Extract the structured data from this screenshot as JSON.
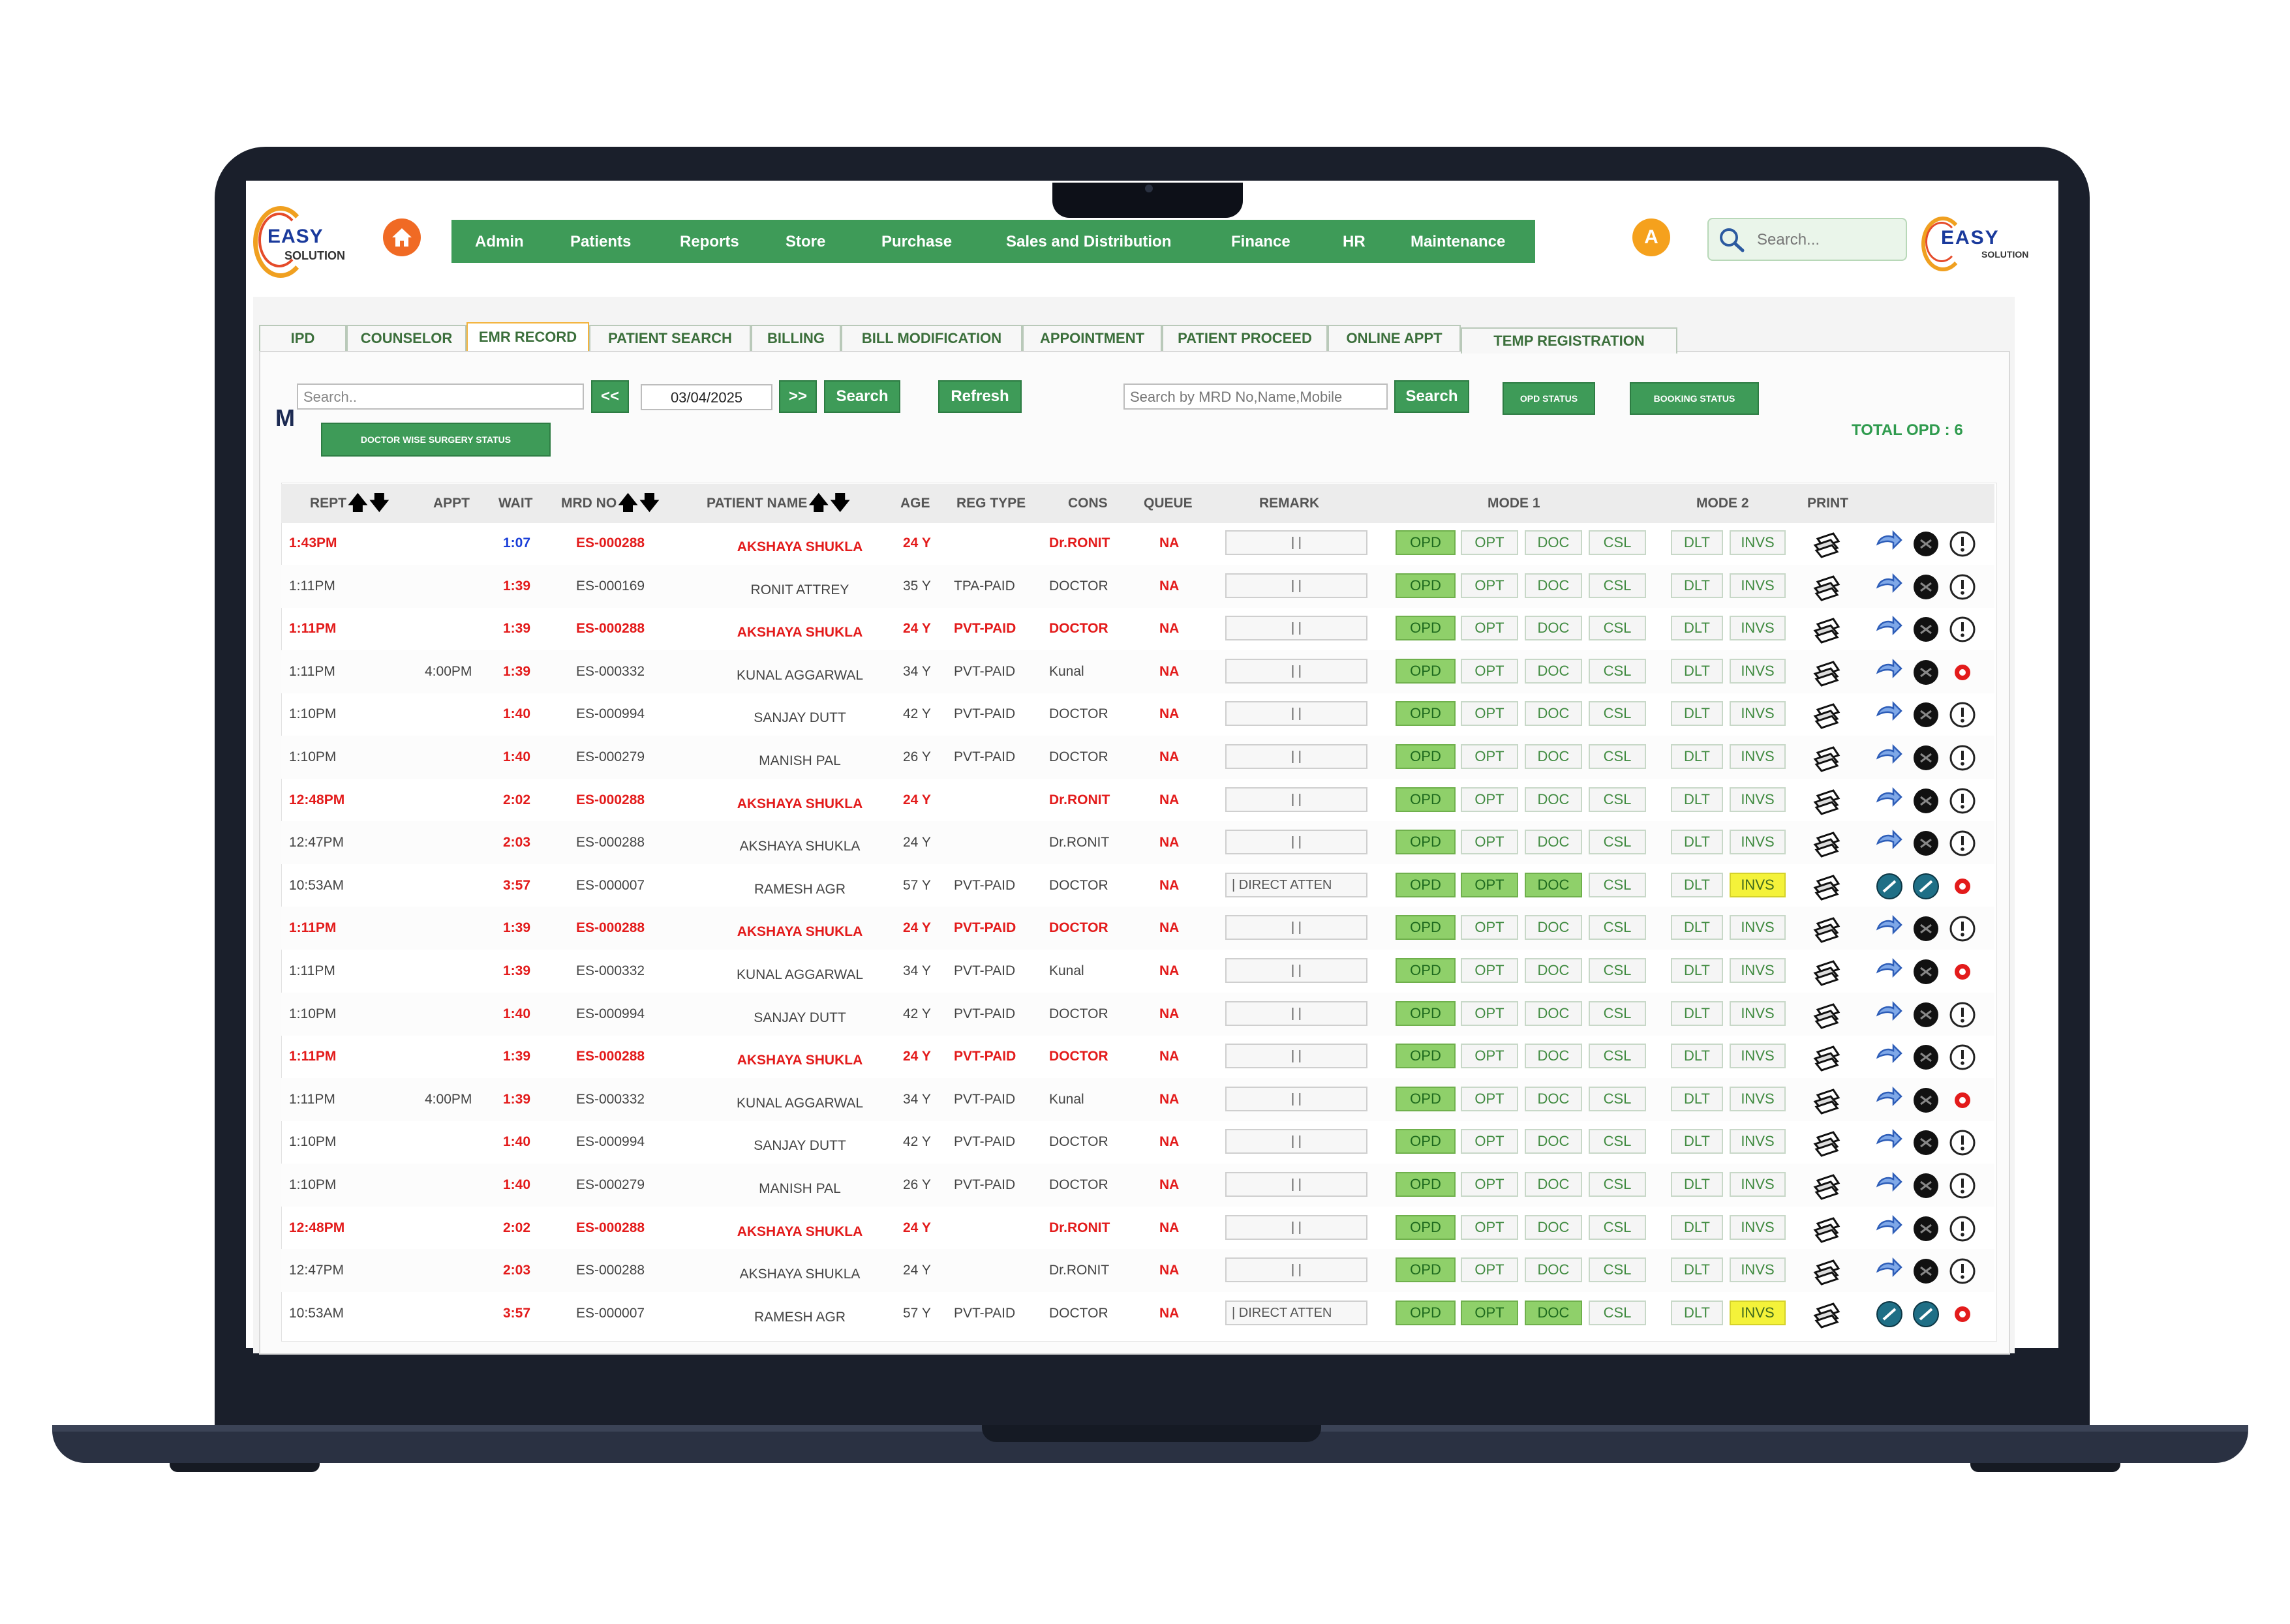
{
  "header": {
    "logo_left": {
      "line1": "EASY",
      "line2": "SOLUTION"
    },
    "logo_right": {
      "line1": "EASY",
      "line2": "SOLUTION"
    },
    "home_icon": "home-icon",
    "nav": [
      "Admin",
      "Patients",
      "Reports",
      "Store",
      "Purchase",
      "Sales and Distribution",
      "Finance",
      "HR",
      "Maintenance"
    ],
    "avatar_letter": "A",
    "search_placeholder": "Search..."
  },
  "tabs": [
    "IPD",
    "COUNSELOR",
    "EMR RECORD",
    "PATIENT SEARCH",
    "BILLING",
    "BILL MODIFICATION",
    "APPOINTMENT",
    "PATIENT PROCEED",
    "ONLINE APPT",
    "TEMP REGISTRATION"
  ],
  "active_tab": "EMR RECORD",
  "toolbar": {
    "search_placeholder": "Search..",
    "prev_label": "<<",
    "date": "03/04/2025",
    "next_label": ">>",
    "search_label": "Search",
    "refresh_label": "Refresh",
    "mrd_placeholder": "Search by MRD No,Name,Mobile",
    "mrd_search_label": "Search",
    "opd_status_label": "OPD STATUS",
    "booking_status_label": "BOOKING STATUS",
    "doctor_surgery_label": "DOCTOR WISE SURGERY STATUS",
    "m_letter": "M",
    "total_opd": "TOTAL OPD : 6"
  },
  "columns": {
    "rept": "REPT",
    "appt": "APPT",
    "wait": "WAIT",
    "mrd": "MRD NO",
    "name": "PATIENT NAME",
    "age": "AGE",
    "regtype": "REG TYPE",
    "cons": "CONS",
    "queue": "QUEUE",
    "remark": "REMARK",
    "mode1": "MODE 1",
    "mode2": "MODE 2",
    "print": "PRINT",
    "sort_up": "🡅",
    "sort_down": "🡇"
  },
  "mode_buttons": {
    "opd": "OPD",
    "opt": "OPT",
    "doc": "DOC",
    "csl": "CSL",
    "dlt": "DLT",
    "invs": "INVS"
  },
  "rows": [
    {
      "rept": "1:43PM",
      "appt": "",
      "wait": "1:07",
      "mrd": "ES-000288",
      "name": "AKSHAYA SHUKLA",
      "age": "24 Y",
      "regtype": "",
      "cons": "Dr.RONIT",
      "queue": "NA",
      "remark": "| |",
      "style": "red",
      "wait_style": "blue",
      "mode": "normal"
    },
    {
      "rept": "1:11PM",
      "appt": "",
      "wait": "1:39",
      "mrd": "ES-000169",
      "name": "RONIT ATTREY",
      "age": "35 Y",
      "regtype": "TPA-PAID",
      "cons": "DOCTOR",
      "queue": "NA",
      "remark": "| |",
      "style": "normal",
      "wait_style": "red",
      "mode": "normal"
    },
    {
      "rept": "1:11PM",
      "appt": "",
      "wait": "1:39",
      "mrd": "ES-000288",
      "name": "AKSHAYA SHUKLA",
      "age": "24 Y",
      "regtype": "PVT-PAID",
      "cons": "DOCTOR",
      "queue": "NA",
      "remark": "| |",
      "style": "red",
      "wait_style": "red",
      "mode": "normal"
    },
    {
      "rept": "1:11PM",
      "appt": "4:00PM",
      "wait": "1:39",
      "mrd": "ES-000332",
      "name": "KUNAL AGGARWAL",
      "age": "34 Y",
      "regtype": "PVT-PAID",
      "cons": "Kunal",
      "queue": "NA",
      "remark": "| |",
      "style": "normal",
      "wait_style": "red",
      "mode": "normal"
    },
    {
      "rept": "1:10PM",
      "appt": "",
      "wait": "1:40",
      "mrd": "ES-000994",
      "name": "SANJAY DUTT",
      "age": "42 Y",
      "regtype": "PVT-PAID",
      "cons": "DOCTOR",
      "queue": "NA",
      "remark": "| |",
      "style": "normal",
      "wait_style": "red",
      "mode": "normal"
    },
    {
      "rept": "1:10PM",
      "appt": "",
      "wait": "1:40",
      "mrd": "ES-000279",
      "name": "MANISH PAL",
      "age": "26 Y",
      "regtype": "PVT-PAID",
      "cons": "DOCTOR",
      "queue": "NA",
      "remark": "| |",
      "style": "normal",
      "wait_style": "red",
      "mode": "normal"
    },
    {
      "rept": "12:48PM",
      "appt": "",
      "wait": "2:02",
      "mrd": "ES-000288",
      "name": "AKSHAYA SHUKLA",
      "age": "24 Y",
      "regtype": "",
      "cons": "Dr.RONIT",
      "queue": "NA",
      "remark": "| |",
      "style": "red",
      "wait_style": "red",
      "mode": "normal"
    },
    {
      "rept": "12:47PM",
      "appt": "",
      "wait": "2:03",
      "mrd": "ES-000288",
      "name": "AKSHAYA SHUKLA",
      "age": "24 Y",
      "regtype": "",
      "cons": "Dr.RONIT",
      "queue": "NA",
      "remark": "| |",
      "style": "normal",
      "wait_style": "red",
      "mode": "normal"
    },
    {
      "rept": "10:53AM",
      "appt": "",
      "wait": "3:57",
      "mrd": "ES-000007",
      "name": "RAMESH AGR",
      "age": "57 Y",
      "regtype": "PVT-PAID",
      "cons": "DOCTOR",
      "queue": "NA",
      "remark": "| DIRECT ATTEN",
      "style": "normal",
      "wait_style": "red",
      "mode": "special"
    },
    {
      "rept": "1:11PM",
      "appt": "",
      "wait": "1:39",
      "mrd": "ES-000288",
      "name": "AKSHAYA SHUKLA",
      "age": "24 Y",
      "regtype": "PVT-PAID",
      "cons": "DOCTOR",
      "queue": "NA",
      "remark": "| |",
      "style": "red",
      "wait_style": "red",
      "mode": "normal"
    },
    {
      "rept": "1:11PM",
      "appt": "",
      "wait": "1:39",
      "mrd": "ES-000332",
      "name": "KUNAL AGGARWAL",
      "age": "34 Y",
      "regtype": "PVT-PAID",
      "cons": "Kunal",
      "queue": "NA",
      "remark": "| |",
      "style": "normal",
      "wait_style": "red",
      "mode": "normal"
    },
    {
      "rept": "1:10PM",
      "appt": "",
      "wait": "1:40",
      "mrd": "ES-000994",
      "name": "SANJAY DUTT",
      "age": "42 Y",
      "regtype": "PVT-PAID",
      "cons": "DOCTOR",
      "queue": "NA",
      "remark": "| |",
      "style": "normal",
      "wait_style": "red",
      "mode": "normal"
    },
    {
      "rept": "1:11PM",
      "appt": "",
      "wait": "1:39",
      "mrd": "ES-000288",
      "name": "AKSHAYA SHUKLA",
      "age": "24 Y",
      "regtype": "PVT-PAID",
      "cons": "DOCTOR",
      "queue": "NA",
      "remark": "| |",
      "style": "red",
      "wait_style": "red",
      "mode": "normal"
    },
    {
      "rept": "1:11PM",
      "appt": "4:00PM",
      "wait": "1:39",
      "mrd": "ES-000332",
      "name": "KUNAL AGGARWAL",
      "age": "34 Y",
      "regtype": "PVT-PAID",
      "cons": "Kunal",
      "queue": "NA",
      "remark": "| |",
      "style": "normal",
      "wait_style": "red",
      "mode": "normal"
    },
    {
      "rept": "1:10PM",
      "appt": "",
      "wait": "1:40",
      "mrd": "ES-000994",
      "name": "SANJAY DUTT",
      "age": "42 Y",
      "regtype": "PVT-PAID",
      "cons": "DOCTOR",
      "queue": "NA",
      "remark": "| |",
      "style": "normal",
      "wait_style": "red",
      "mode": "normal"
    },
    {
      "rept": "1:10PM",
      "appt": "",
      "wait": "1:40",
      "mrd": "ES-000279",
      "name": "MANISH PAL",
      "age": "26 Y",
      "regtype": "PVT-PAID",
      "cons": "DOCTOR",
      "queue": "NA",
      "remark": "| |",
      "style": "normal",
      "wait_style": "red",
      "mode": "normal"
    },
    {
      "rept": "12:48PM",
      "appt": "",
      "wait": "2:02",
      "mrd": "ES-000288",
      "name": "AKSHAYA SHUKLA",
      "age": "24 Y",
      "regtype": "",
      "cons": "Dr.RONIT",
      "queue": "NA",
      "remark": "| |",
      "style": "red",
      "wait_style": "red",
      "mode": "normal"
    },
    {
      "rept": "12:47PM",
      "appt": "",
      "wait": "2:03",
      "mrd": "ES-000288",
      "name": "AKSHAYA SHUKLA",
      "age": "24 Y",
      "regtype": "",
      "cons": "Dr.RONIT",
      "queue": "NA",
      "remark": "| |",
      "style": "normal",
      "wait_style": "red",
      "mode": "normal"
    },
    {
      "rept": "10:53AM",
      "appt": "",
      "wait": "3:57",
      "mrd": "ES-000007",
      "name": "RAMESH AGR",
      "age": "57 Y",
      "regtype": "PVT-PAID",
      "cons": "DOCTOR",
      "queue": "NA",
      "remark": "| DIRECT ATTEN",
      "style": "normal",
      "wait_style": "red",
      "mode": "special"
    }
  ],
  "row_icon_variant": [
    "a",
    "a",
    "a",
    "b",
    "a",
    "a",
    "a",
    "a",
    "c",
    "a",
    "b",
    "a",
    "a",
    "b",
    "a",
    "a",
    "a",
    "a",
    "c"
  ],
  "colors": {
    "green": "#3e9b58",
    "red": "#e31b1b",
    "blue": "#1a3ed8",
    "active_green": "#8fd06a",
    "highlight_yellow": "#f4f23a",
    "orange": "#f06a24"
  }
}
